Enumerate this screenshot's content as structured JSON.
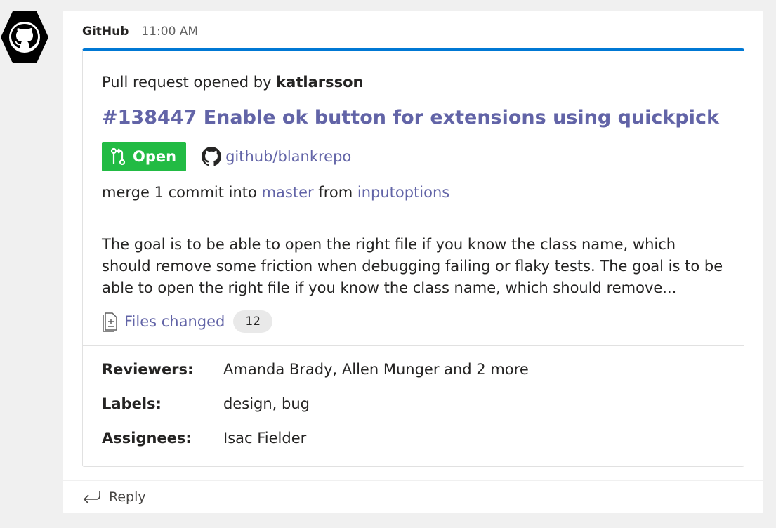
{
  "message": {
    "sender": "GitHub",
    "timestamp": "11:00 AM"
  },
  "card": {
    "opened_prefix": "Pull request opened by ",
    "opened_user": "katlarsson",
    "pr_title": "#138447 Enable ok button for extensions using quickpick",
    "status": "Open",
    "repo": "github/blankrepo",
    "merge_prefix": "merge 1 commit into ",
    "merge_target": "master",
    "merge_mid": " from ",
    "merge_source": "inputoptions",
    "description": "The goal is to be able to open the right file if you know the class name, which should remove some friction when debugging failing or flaky tests. The goal is to be able to open the right file if you know the class name, which should remove...",
    "files_changed_label": "Files changed",
    "files_changed_count": "12",
    "fields": {
      "reviewers_label": "Reviewers:",
      "reviewers_value": "Amanda Brady, Allen Munger and 2 more",
      "labels_label": "Labels:",
      "labels_value": "design, bug",
      "assignees_label": "Assignees:",
      "assignees_value": "Isac Fielder"
    }
  },
  "reply": {
    "label": "Reply"
  },
  "colors": {
    "accent": "#6264a7",
    "card_top_border": "#0078d4",
    "open_badge": "#22bb44",
    "background": "#f0f0f0"
  },
  "icons": [
    "github-logo-icon",
    "git-pull-request-icon",
    "github-octocat-icon",
    "file-diff-icon",
    "reply-arrow-icon"
  ]
}
